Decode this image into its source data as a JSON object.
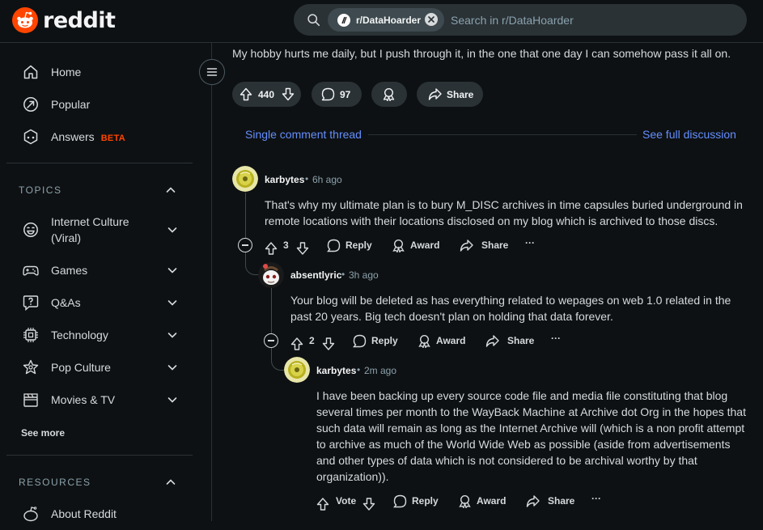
{
  "header": {
    "logo_text": "reddit",
    "search": {
      "chip_label": "r/DataHoarder",
      "placeholder": "Search in r/DataHoarder"
    }
  },
  "sidebar": {
    "nav": [
      {
        "label": "Home",
        "icon": "home-icon"
      },
      {
        "label": "Popular",
        "icon": "popular-icon"
      },
      {
        "label": "Answers",
        "icon": "answers-icon",
        "badge": "BETA"
      }
    ],
    "topics_title": "TOPICS",
    "topics": [
      {
        "label": "Internet Culture (Viral)",
        "icon": "internet-culture-icon"
      },
      {
        "label": "Games",
        "icon": "gamepad-icon"
      },
      {
        "label": "Q&As",
        "icon": "qa-icon"
      },
      {
        "label": "Technology",
        "icon": "chip-icon"
      },
      {
        "label": "Pop Culture",
        "icon": "star-icon"
      },
      {
        "label": "Movies & TV",
        "icon": "clapperboard-icon"
      }
    ],
    "see_more": "See more",
    "resources_title": "RESOURCES",
    "resources": [
      {
        "label": "About Reddit",
        "icon": "reddit-icon"
      }
    ]
  },
  "post": {
    "text": "My hobby hurts me daily, but I push through it, in the one that one day I can somehow pass it all on.",
    "votes": "440",
    "comments": "97",
    "share": "Share"
  },
  "thread": {
    "single_label": "Single comment thread",
    "full_label": "See full discussion"
  },
  "comments": [
    {
      "author": "karbytes",
      "dot": "•",
      "time": "6h ago",
      "body": "That's why my ultimate plan is to bury M_DISC archives in time capsules buried underground in remote locations with their locations disclosed on my blog which is archived to those discs.",
      "votes": "3",
      "reply": "Reply",
      "award": "Award",
      "share": "Share",
      "more": "···"
    },
    {
      "author": "absentlyric",
      "dot": "•",
      "time": "3h ago",
      "body": "Your blog will be deleted as has everything related to wepages on web 1.0 related in the past 20 years. Big tech doesn't plan on holding that data forever.",
      "votes": "2",
      "reply": "Reply",
      "award": "Award",
      "share": "Share",
      "more": "···"
    },
    {
      "author": "karbytes",
      "dot": "•",
      "time": "2m ago",
      "body": "I have been backing up every source code file and media file constituting that blog several times per month to the WayBack Machine at Archive dot Org in the hopes that such data will remain as long as the Internet Archive will (which is a non profit attempt to archive as much of the World Wide Web as possible (aside from advertisements and other types of data which is not considered to be archival worthy by that organization)).",
      "votes": "Vote",
      "reply": "Reply",
      "award": "Award",
      "share": "Share",
      "more": "···"
    }
  ],
  "colors": {
    "brand": "#ff4500",
    "link": "#648efc",
    "background": "#0e1113"
  }
}
